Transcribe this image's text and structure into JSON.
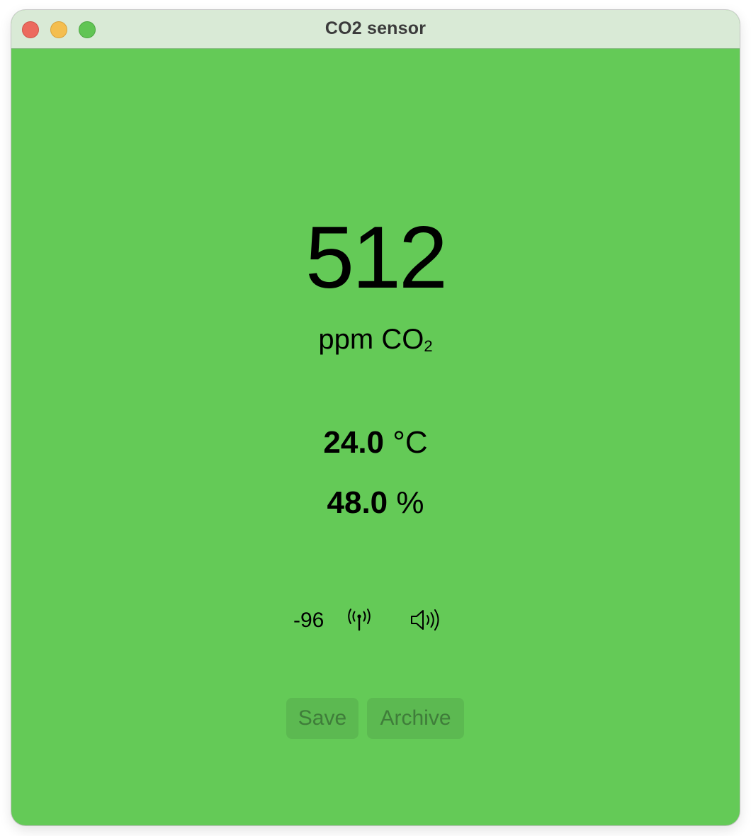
{
  "window": {
    "title": "CO2 sensor"
  },
  "co2": {
    "value": "512",
    "unit_main": "ppm CO",
    "unit_sub": "2"
  },
  "temperature": {
    "value": "24.0",
    "unit": "°C"
  },
  "humidity": {
    "value": "48.0",
    "unit": "%"
  },
  "status": {
    "rssi": "-96",
    "signal_icon": "antenna-signal-icon",
    "sound_icon": "speaker-wave-icon"
  },
  "actions": {
    "save_label": "Save",
    "archive_label": "Archive"
  },
  "colors": {
    "background": "#64ca57",
    "titlebar": "#d9ead6",
    "button_bg": "#5cb951",
    "button_text": "#3f7d3a"
  }
}
